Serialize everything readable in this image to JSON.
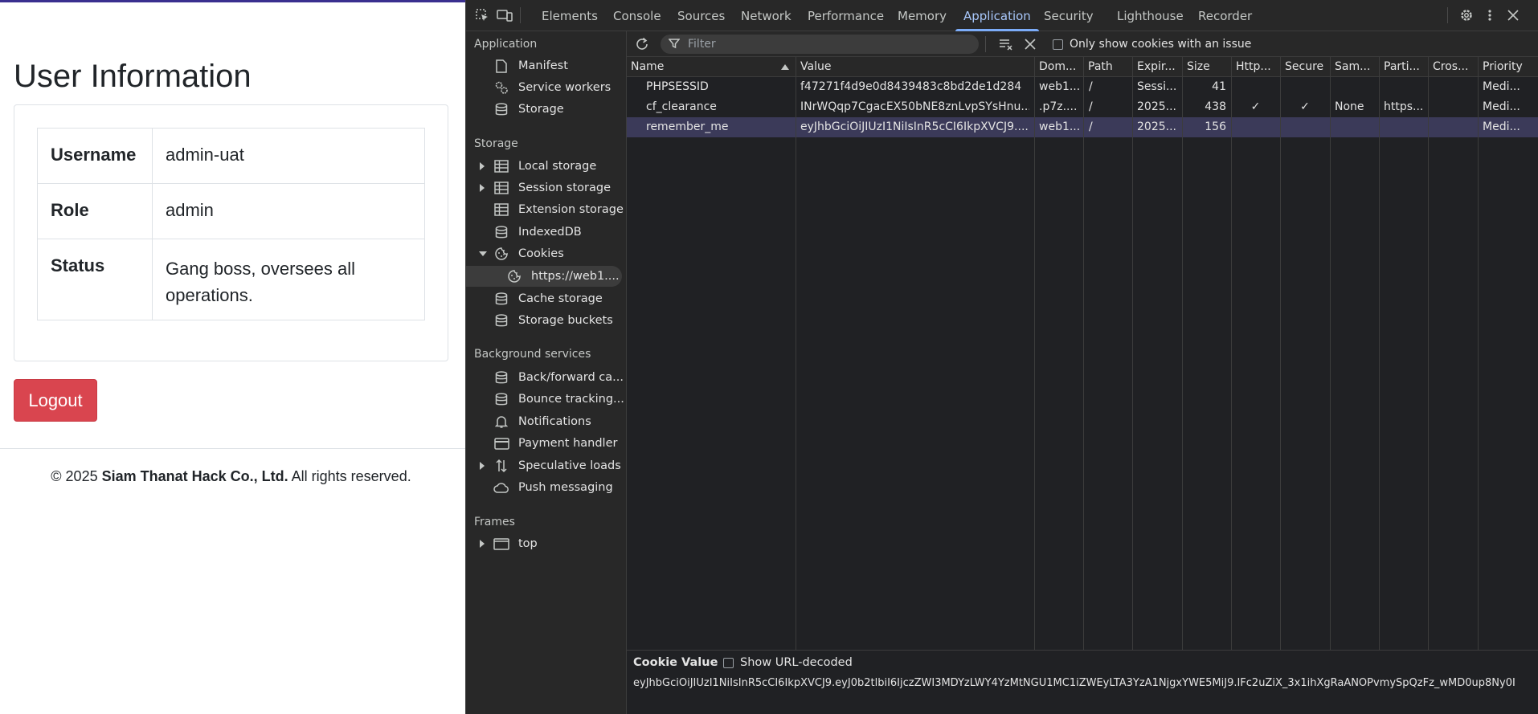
{
  "page": {
    "heading": "User Information",
    "rows": [
      {
        "key": "Username",
        "value": "admin-uat"
      },
      {
        "key": "Role",
        "value": "admin"
      },
      {
        "key": "Status",
        "value": "Gang boss, oversees all operations."
      }
    ],
    "logout_label": "Logout",
    "footer": {
      "prefix": "© 2025 ",
      "company": "Siam Thanat Hack Co., Ltd.",
      "suffix": " All rights reserved."
    },
    "colors": {
      "logout_bg": "#d9454f",
      "top_border": "#3a2f8f"
    }
  },
  "devtools": {
    "tabs": [
      "Elements",
      "Console",
      "Sources",
      "Network",
      "Performance",
      "Memory",
      "Application",
      "Security",
      "Lighthouse",
      "Recorder"
    ],
    "active_tab": "Application",
    "sidebar": {
      "application_header": "Application",
      "application_items": [
        "Manifest",
        "Service workers",
        "Storage"
      ],
      "storage_header": "Storage",
      "storage_items": [
        "Local storage",
        "Session storage",
        "Extension storage",
        "IndexedDB",
        "Cookies",
        "https://web1....",
        "Cache storage",
        "Storage buckets"
      ],
      "background_header": "Background services",
      "background_items": [
        "Back/forward ca...",
        "Bounce tracking...",
        "Notifications",
        "Payment handler",
        "Speculative loads",
        "Push messaging"
      ],
      "frames_header": "Frames",
      "frames_items": [
        "top"
      ]
    },
    "toolbar": {
      "filter_placeholder": "Filter",
      "only_issue_label": "Only show cookies with an issue"
    },
    "columns": [
      "Name",
      "Value",
      "Dom...",
      "Path",
      "Expir...",
      "Size",
      "Http...",
      "Secure",
      "Sam...",
      "Parti...",
      "Cros...",
      "Priority"
    ],
    "cookies": [
      {
        "name": "PHPSESSID",
        "value": "f47271f4d9e0d8439483c8bd2de1d284",
        "domain": "web1...",
        "path": "/",
        "expires": "Sessi...",
        "size": "41",
        "http": "",
        "secure": "",
        "samesite": "",
        "partition": "",
        "cross": "",
        "priority": "Medi..."
      },
      {
        "name": "cf_clearance",
        "value": "INrWQqp7CgacEX50bNE8znLvpSYsHnu...",
        "domain": ".p7z....",
        "path": "/",
        "expires": "2025...",
        "size": "438",
        "http": "✓",
        "secure": "✓",
        "samesite": "None",
        "partition": "https...",
        "cross": "",
        "priority": "Medi..."
      },
      {
        "name": "remember_me",
        "value": "eyJhbGciOiJIUzI1NiIsInR5cCI6IkpXVCJ9....",
        "domain": "web1...",
        "path": "/",
        "expires": "2025...",
        "size": "156",
        "http": "",
        "secure": "",
        "samesite": "",
        "partition": "",
        "cross": "",
        "priority": "Medi..."
      }
    ],
    "selected_row": 2,
    "cookie_value_panel": {
      "title": "Cookie Value",
      "show_decoded_label": "Show URL-decoded",
      "value": "eyJhbGciOiJIUzI1NiIsInR5cCI6IkpXVCJ9.eyJ0b2tlbiI6IjczZWI3MDYzLWY4YzMtNGU1MC1iZWEyLTA3YzA1NjgxYWE5MiJ9.IFc2uZiX_3x1ihXgRaANOPvmySpQzFz_wMD0up8Ny0I"
    }
  }
}
